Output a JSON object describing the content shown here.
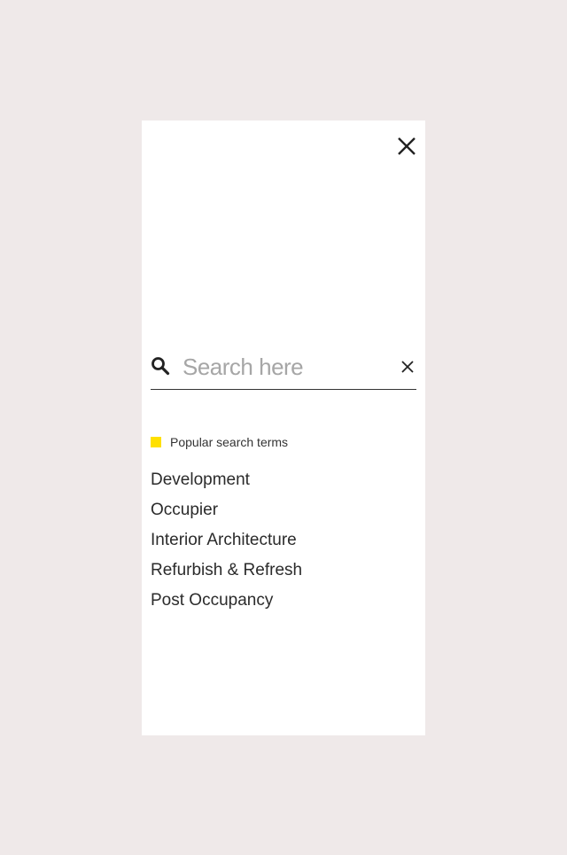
{
  "search": {
    "placeholder": "Search here",
    "value": ""
  },
  "popular": {
    "label": "Popular search terms",
    "marker_color": "#ffe000",
    "terms": [
      "Development",
      "Occupier",
      "Interior Architecture",
      "Refurbish & Refresh",
      "Post Occupancy"
    ]
  },
  "icons": {
    "close": "close-icon",
    "search": "search-icon",
    "clear": "clear-icon"
  },
  "colors": {
    "background": "#efe9e9",
    "panel": "#ffffff",
    "accent": "#ffe000",
    "text": "#2b2b2b",
    "placeholder": "#a6a6a6"
  }
}
